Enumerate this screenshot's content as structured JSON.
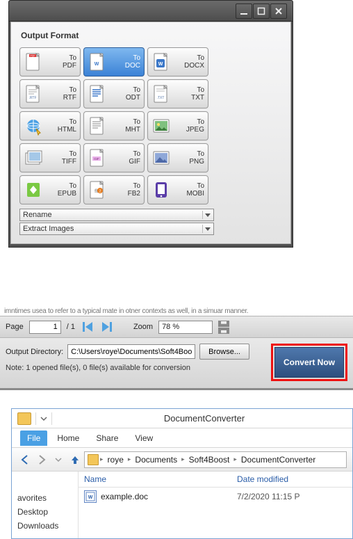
{
  "window1": {
    "panel_title": "Output Format",
    "formats": [
      {
        "to": "To",
        "name": "PDF",
        "icon": "pdf",
        "selected": false
      },
      {
        "to": "To",
        "name": "DOC",
        "icon": "doc",
        "selected": true
      },
      {
        "to": "To",
        "name": "DOCX",
        "icon": "docx",
        "selected": false
      },
      {
        "to": "To",
        "name": "RTF",
        "icon": "rtf",
        "selected": false
      },
      {
        "to": "To",
        "name": "ODT",
        "icon": "odt",
        "selected": false
      },
      {
        "to": "To",
        "name": "TXT",
        "icon": "txt",
        "selected": false
      },
      {
        "to": "To",
        "name": "HTML",
        "icon": "html",
        "selected": false
      },
      {
        "to": "To",
        "name": "MHT",
        "icon": "mht",
        "selected": false
      },
      {
        "to": "To",
        "name": "JPEG",
        "icon": "jpeg",
        "selected": false
      },
      {
        "to": "To",
        "name": "TIFF",
        "icon": "tiff",
        "selected": false
      },
      {
        "to": "To",
        "name": "GIF",
        "icon": "gif",
        "selected": false
      },
      {
        "to": "To",
        "name": "PNG",
        "icon": "png",
        "selected": false
      },
      {
        "to": "To",
        "name": "EPUB",
        "icon": "epub",
        "selected": false
      },
      {
        "to": "To",
        "name": "FB2",
        "icon": "fb2",
        "selected": false
      },
      {
        "to": "To",
        "name": "MOBI",
        "icon": "mobi",
        "selected": false
      }
    ],
    "rename_combo": "Rename",
    "extract_combo": "Extract Images"
  },
  "toolbar": {
    "page_label": "Page",
    "page_value": "1",
    "page_total": "/ 1",
    "zoom_label": "Zoom",
    "zoom_value": "78 %"
  },
  "output": {
    "dir_label": "Output Directory:",
    "dir_value": "C:\\Users\\roye\\Documents\\Soft4Boo",
    "browse_label": "Browse...",
    "note": "Note: 1 opened file(s), 0 file(s) available for conversion",
    "convert_label": "Convert Now"
  },
  "cutoff_text": "imntimes usea to refer to a typical mate in otner contexts as well, in a simuar manner.",
  "explorer": {
    "title": "DocumentConverter",
    "tabs": {
      "file": "File",
      "home": "Home",
      "share": "Share",
      "view": "View"
    },
    "breadcrumb": [
      "roye",
      "Documents",
      "Soft4Boost",
      "DocumentConverter"
    ],
    "nav_items": {
      "favorites": "avorites",
      "desktop": "Desktop",
      "downloads": "Downloads"
    },
    "columns": {
      "name": "Name",
      "date": "Date modified"
    },
    "files": [
      {
        "name": "example.doc",
        "date": "7/2/2020 11:15 P"
      }
    ]
  }
}
